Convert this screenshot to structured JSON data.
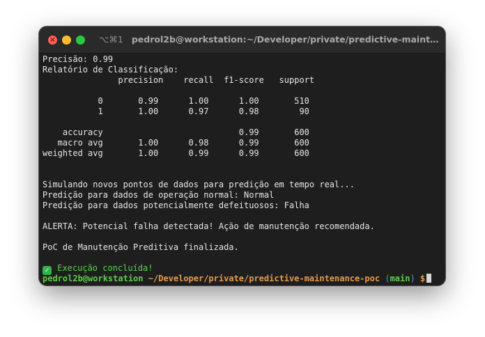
{
  "window": {
    "shortcut": "⌥⌘1",
    "title": "pedrol2b@workstation:~/Developer/private/predictive-maintenance-poc"
  },
  "terminal": {
    "lines": [
      "Precisão: 0.99",
      "Relatório de Classificação:",
      "               precision    recall  f1-score   support",
      "",
      "           0       0.99      1.00      1.00       510",
      "           1       1.00      0.97      0.98        90",
      "",
      "    accuracy                           0.99       600",
      "   macro avg       1.00      0.98      0.99       600",
      "weighted avg       1.00      0.99      0.99       600",
      "",
      "",
      "Simulando novos pontos de dados para predição em tempo real...",
      "Predição para dados de operação normal: Normal",
      "Predição para dados potencialmente defeituosos: Falha",
      "",
      "ALERTA: Potencial falha detectada! Ação de manutenção recomendada.",
      "",
      "PoC de Manutenção Preditiva finalizada.",
      ""
    ],
    "success_icon": "check-mark-button",
    "success_message": "Execução concluída!",
    "prompt": {
      "user_host": "pedrol2b@workstation",
      "path": "~/Developer/private/predictive-maintenance-poc",
      "paren_open": "(",
      "branch": "main",
      "paren_close": ")",
      "symbol": "$"
    }
  },
  "colors": {
    "background": "#1e1e1e",
    "titlebar": "#2a2a2a",
    "text": "#e6e6e6",
    "success": "#57d44a",
    "prompt_user": "#5ccf4a",
    "prompt_path": "#e49a4a",
    "prompt_branch": "#5ccf4a",
    "prompt_paren": "#6a86e8"
  }
}
